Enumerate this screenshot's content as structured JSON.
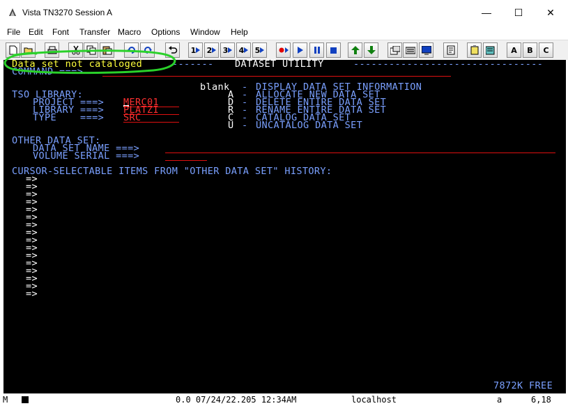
{
  "window": {
    "title": "Vista TN3270 Session A",
    "minimize_glyph": "—",
    "maximize_glyph": "☐",
    "close_glyph": "✕"
  },
  "menu": [
    "File",
    "Edit",
    "Font",
    "Transfer",
    "Macro",
    "Options",
    "Window",
    "Help"
  ],
  "toolbar": {
    "icons": [
      "new-icon",
      "open-icon",
      "print-icon",
      "cut-icon",
      "copy-icon",
      "paste-icon",
      "refresh-icon",
      "refresh-alt-icon",
      "undo-icon",
      "play-1-icon",
      "play-2-icon",
      "play-3-icon",
      "play-4-icon",
      "play-5-icon",
      "record-icon",
      "play-icon",
      "pause-icon",
      "stop-icon",
      "upload-icon",
      "download-icon",
      "session-icon",
      "keyboard-icon",
      "screen-icon",
      "properties-icon",
      "clipboard-icon",
      "notes-icon"
    ],
    "keys": [
      "A",
      "B",
      "C"
    ]
  },
  "screen": {
    "message": "Data set not cataloged",
    "header_dashes_left": "-------",
    "header_title": "DATASET UTILITY",
    "header_dashes_right": "--------------------------------",
    "command_label": "COMMAND ===>",
    "options": [
      {
        "key": "blank",
        "sep": "-",
        "desc": "DISPLAY DATA SET INFORMATION"
      },
      {
        "key": "A",
        "sep": "-",
        "desc": "ALLOCATE NEW DATA SET"
      },
      {
        "key": "D",
        "sep": "-",
        "desc": "DELETE ENTIRE DATA SET"
      },
      {
        "key": "R",
        "sep": "-",
        "desc": "RENAME ENTIRE DATA SET"
      },
      {
        "key": "C",
        "sep": "-",
        "desc": "CATALOG DATA SET"
      },
      {
        "key": "U",
        "sep": "-",
        "desc": "UNCATALOG DATA SET"
      }
    ],
    "tso_library_label": "TSO LIBRARY:",
    "project_label": "PROJECT ===>",
    "project_value": "MERC01",
    "library_label": "LIBRARY ===>",
    "library_value": "PLATZI",
    "type_label": "TYPE    ===>",
    "type_value": "SRC",
    "other_data_set_label": "OTHER DATA SET:",
    "data_set_name_label": "DATA SET NAME ===>",
    "volume_serial_label": "VOLUME SERIAL ===>",
    "history_label": "CURSOR-SELECTABLE ITEMS FROM \"OTHER DATA SET\" HISTORY:",
    "history_prompt": "=>",
    "history_rows": 16,
    "memory": "7872K FREE"
  },
  "status": {
    "mode": "M",
    "time_info": "0.0 07/24/22.205 12:34AM",
    "host": "localhost",
    "field_indicator": "a",
    "cursor": "6,18"
  }
}
